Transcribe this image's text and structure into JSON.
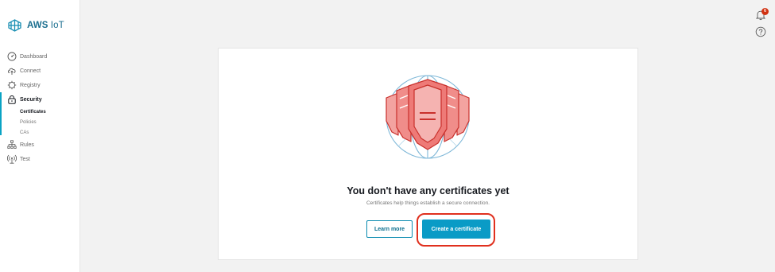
{
  "brand": {
    "name": "AWS",
    "product": "IoT"
  },
  "nav": {
    "dashboard": "Dashboard",
    "connect": "Connect",
    "registry": "Registry",
    "security": "Security",
    "security_items": [
      "Certificates",
      "Policies",
      "CAs"
    ],
    "rules": "Rules",
    "test": "Test"
  },
  "topbar": {
    "notification_count": "6"
  },
  "empty_state": {
    "title": "You don't have any certificates yet",
    "subtitle": "Certificates help things establish a secure connection.",
    "learn_more": "Learn more",
    "create": "Create a certificate"
  },
  "colors": {
    "accent": "#0a9bc6",
    "brand": "#1a6e8f",
    "highlight": "#e0301e",
    "badge": "#d13212"
  },
  "icons": {
    "brand": "aws-iot-logo-icon",
    "dashboard": "dashboard-gauge-icon",
    "connect": "cloud-upload-icon",
    "registry": "gear-icon",
    "security": "lock-icon",
    "rules": "hierarchy-icon",
    "test": "broadcast-icon",
    "notifications": "bell-icon",
    "help": "help-circle-icon"
  }
}
